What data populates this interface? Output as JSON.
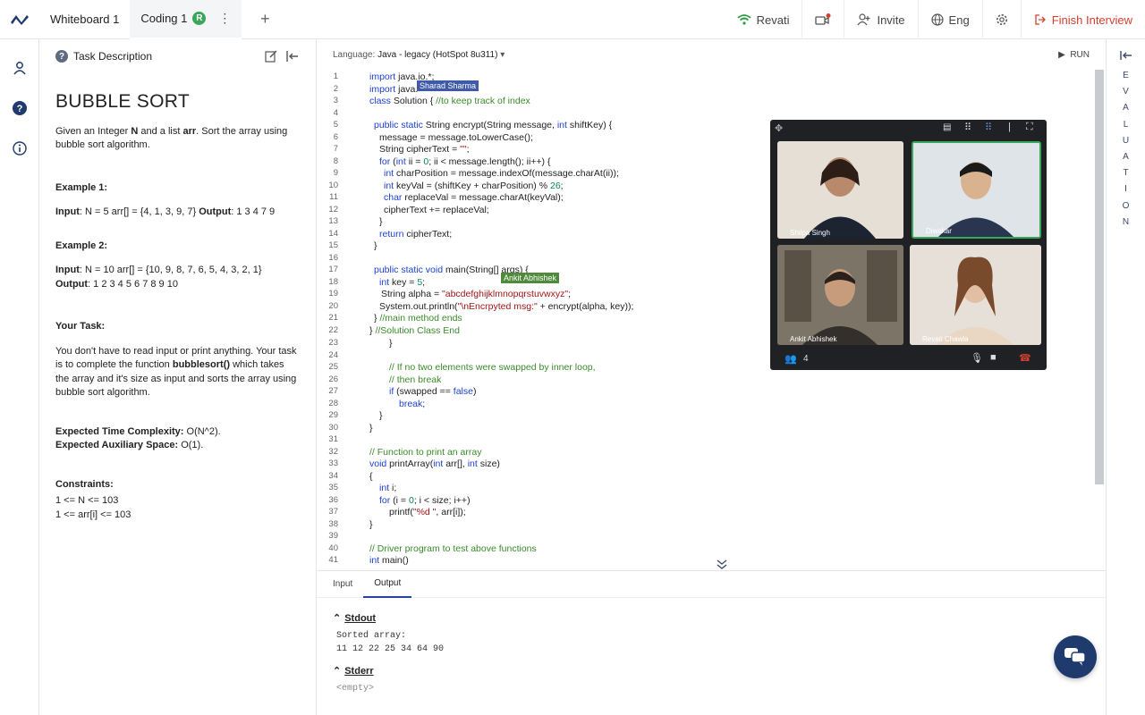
{
  "topbar": {
    "tabs": [
      {
        "label": "Whiteboard 1"
      },
      {
        "label": "Coding 1",
        "badge": "R"
      }
    ],
    "user_name": "Revati",
    "invite_label": "Invite",
    "language_label": "Eng",
    "finish_label": "Finish Interview"
  },
  "task": {
    "header": "Task Description",
    "title": "BUBBLE SORT",
    "intro": {
      "p1": "Given an Integer ",
      "n": "N",
      "p2": " and a list ",
      "arr": "arr",
      "p3": ". Sort the array using bubble sort algorithm."
    },
    "example1": {
      "heading": "Example 1:",
      "input_label": "Input",
      "input_text": ": N = 5 arr[] = {4, 1, 3, 9, 7} ",
      "output_label": "Output",
      "output_text": ": 1 3 4 7 9"
    },
    "example2": {
      "heading": "Example 2:",
      "input_label": "Input",
      "input_text": ": N = 10 arr[] = {10, 9, 8, 7, 6, 5, 4, 3, 2, 1}",
      "output_label": "Output",
      "output_text": ": 1 2 3 4 5 6 7 8 9 10"
    },
    "your_task": {
      "heading": "Your Task:",
      "p1": "You don't have to read input or print anything. Your task is to complete the function ",
      "fn": "bubblesort()",
      "p2": " which takes the array and it's size as input and sorts the array using bubble sort algorithm."
    },
    "complexity": {
      "time_label": "Expected Time Complexity:",
      "time_value": " O(N^2).",
      "space_label": "Expected Auxiliary Space:",
      "space_value": " O(1)."
    },
    "constraints": {
      "heading": "Constraints:",
      "c1": "1 <= N <= 103",
      "c2": "1 <= arr[i] <= 103"
    }
  },
  "editor": {
    "language_label": "Language:",
    "language_value": "Java - legacy (HotSpot 8u311)",
    "run_label": "RUN",
    "cursors": [
      {
        "name": "Sharad Sharma",
        "color": "#3f5aa8"
      },
      {
        "name": "Ankit Abhishek",
        "color": "#4f8a3c"
      }
    ]
  },
  "video": {
    "participants": [
      {
        "name": "Shilpa Singh",
        "bg": "#d7c9b6"
      },
      {
        "name": "Diwakar",
        "bg": "#cfd6dd"
      },
      {
        "name": "Ankit Abhishek",
        "bg": "#8c8577"
      },
      {
        "name": "Revati Chawla",
        "bg": "#d9d2c9"
      }
    ],
    "participant_count": "4"
  },
  "io": {
    "tabs": [
      "Input",
      "Output"
    ],
    "stdout_label": "Stdout",
    "stdout_text": "Sorted array:",
    "stdout_values": "11 12 22 25 34 64 90",
    "stderr_label": "Stderr",
    "stderr_text": "<empty>"
  },
  "eval_rail": {
    "letters": [
      "E",
      "V",
      "A",
      "L",
      "U",
      "A",
      "T",
      "I",
      "O",
      "N"
    ]
  },
  "colors": {
    "accent": "#1d3fd1",
    "finish": "#d2402f",
    "success": "#3aa65a",
    "wifi": "#2e9b48"
  }
}
